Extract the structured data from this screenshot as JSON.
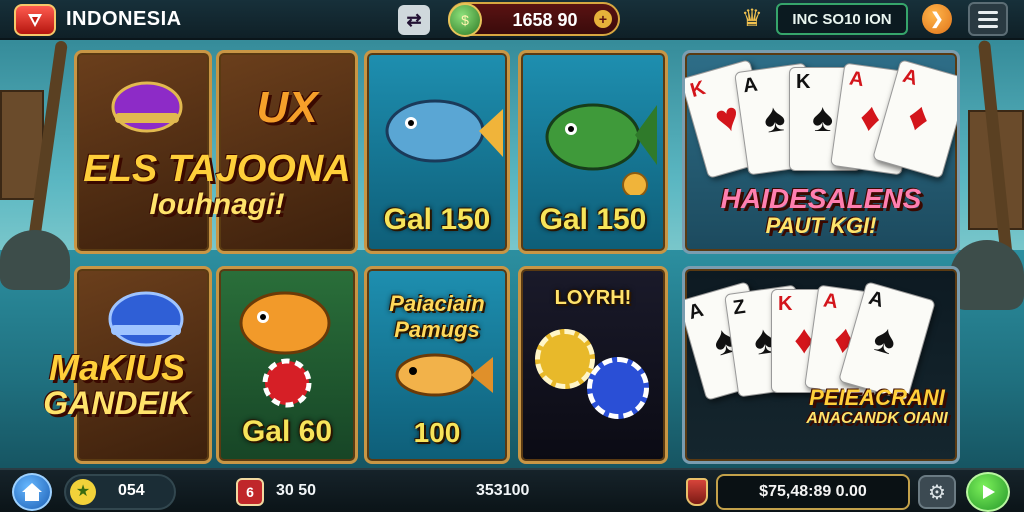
{
  "topbar": {
    "brand": "INDONESIA",
    "coin_balance": "1658 90",
    "player_id": "INC SO10 ION",
    "icons": {
      "logo": "lobby-logo-icon",
      "swap": "swap-icon",
      "coin": "coin-icon",
      "trophy": "trophy-icon",
      "notice": "notice-icon",
      "menu": "menu-icon"
    }
  },
  "tiles": [
    {
      "id": "tile-1",
      "top_text": "",
      "caption": "",
      "icon": "helmet-icon"
    },
    {
      "id": "tile-2",
      "top_text": "UX",
      "caption": ""
    },
    {
      "id": "tile-3",
      "top_text": "",
      "caption": "Gal 150",
      "icon": "fish-icon"
    },
    {
      "id": "tile-4",
      "top_text": "",
      "caption": "Gal 150",
      "icon": "fish-icon"
    },
    {
      "id": "tile-5",
      "top_text": "",
      "caption": "",
      "icon": "poker-cards-icon"
    },
    {
      "id": "tile-6",
      "top_text": "",
      "caption": "",
      "icon": "blue-helmet-icon"
    },
    {
      "id": "tile-7",
      "top_text": "",
      "caption": "Gal 60",
      "icon": "fish-chip-icon"
    },
    {
      "id": "tile-8",
      "top_text": "Paiaciain Pamugs",
      "caption": "100",
      "icon": "fish-icon"
    },
    {
      "id": "tile-9",
      "top_text": "LOYRH!",
      "caption": "",
      "icon": "chips-icon"
    },
    {
      "id": "tile-10",
      "top_text": "",
      "caption": "",
      "icon": "poker-cards-icon"
    }
  ],
  "overlays": {
    "title_top_left_line1": "ELS TAJOONA",
    "title_top_left_line2": "Iouhnagi!",
    "title_right_top_line1": "HAIDESALENS",
    "title_right_top_line2": "PAUT KGI!",
    "title_bottom_left_line1": "MaKIUS",
    "title_bottom_left_line2": "GANDEIK",
    "title_right_bottom_line1": "PEIEACRANI",
    "title_right_bottom_line2": "ANACANDK OIANI"
  },
  "cards_top": [
    {
      "rank": "K",
      "suit": "♥",
      "color": "#d3151b"
    },
    {
      "rank": "A",
      "suit": "♠",
      "color": "#111111"
    },
    {
      "rank": "K",
      "suit": "♠",
      "color": "#111111"
    },
    {
      "rank": "A",
      "suit": "♦",
      "color": "#d3151b"
    },
    {
      "rank": "A",
      "suit": "♦",
      "color": "#d3151b"
    }
  ],
  "cards_bottom": [
    {
      "rank": "A",
      "suit": "♠",
      "color": "#111111"
    },
    {
      "rank": "Z",
      "suit": "♠",
      "color": "#111111"
    },
    {
      "rank": "K",
      "suit": "♦",
      "color": "#d3151b"
    },
    {
      "rank": "A",
      "suit": "♦",
      "color": "#d3151b"
    },
    {
      "rank": "A",
      "suit": "♠",
      "color": "#111111"
    }
  ],
  "bottombar": {
    "level_value": "054",
    "ticket_badge": "6",
    "ticket_value": "30 50",
    "center_value": "353100",
    "balance": "$75,48:89 0.00",
    "icons": {
      "home": "home-icon",
      "level": "star-icon",
      "ticket": "ticket-icon",
      "shield": "shield-icon",
      "settings": "gear-icon",
      "play": "play-icon"
    }
  },
  "colors": {
    "gold": "#c89645",
    "topbar": "#0f2027",
    "coin_pill": "#5a1212",
    "id_border": "#36a56b",
    "play_green": "#25982a",
    "home_blue": "#1c5fb4"
  }
}
